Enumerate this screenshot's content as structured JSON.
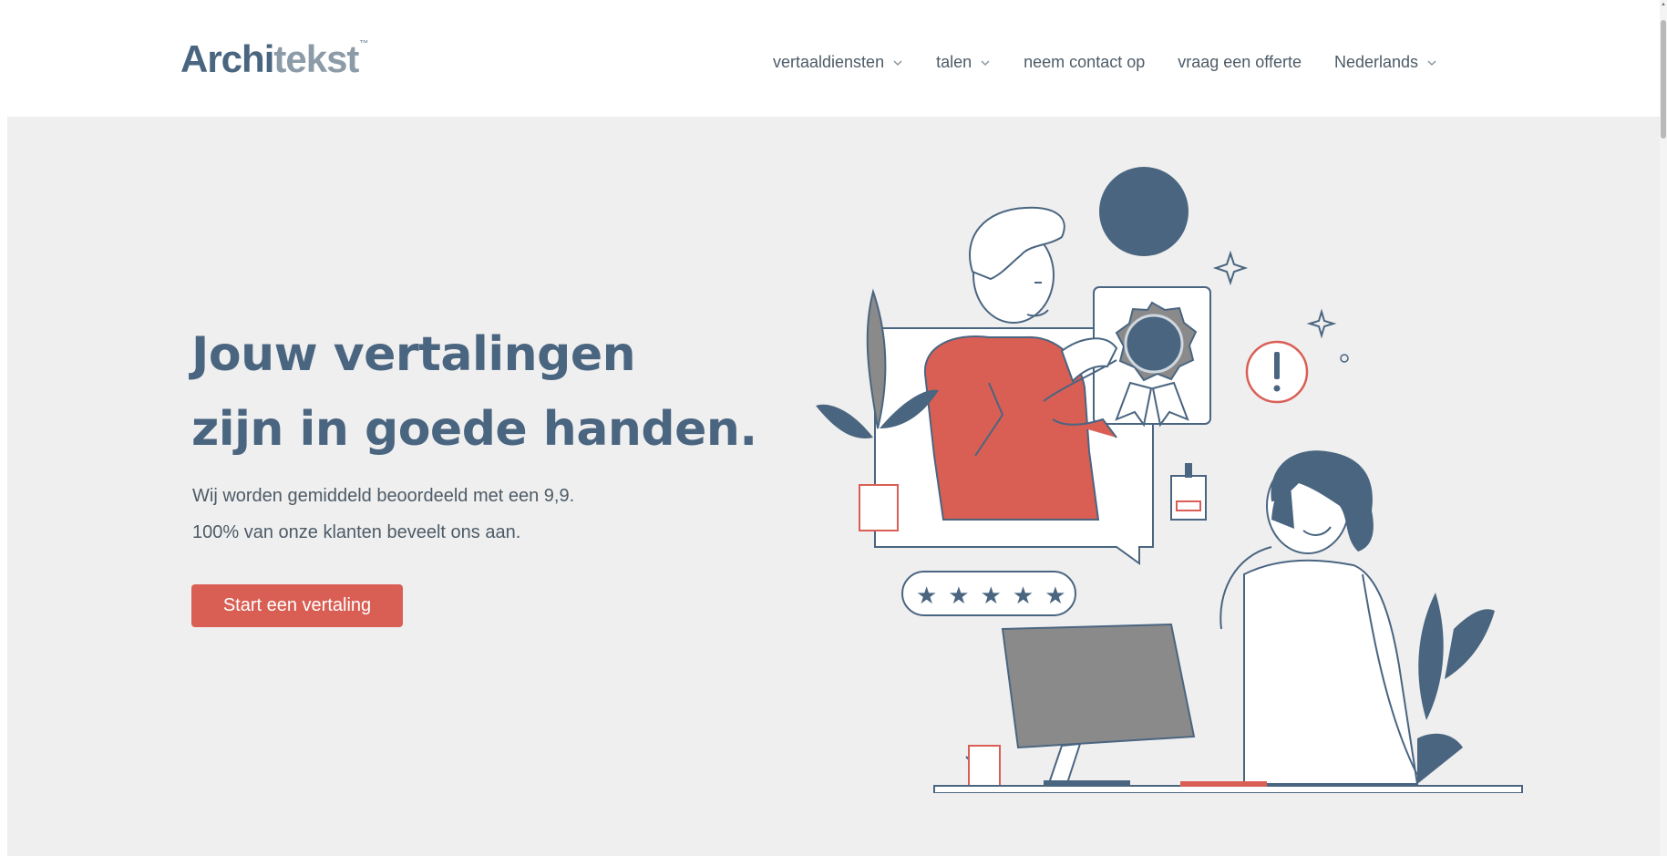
{
  "header": {
    "logo": {
      "part_a": "Archi",
      "part_b": "tekst",
      "trademark": "™"
    },
    "nav": [
      {
        "label": "vertaaldiensten",
        "has_dropdown": true
      },
      {
        "label": "talen",
        "has_dropdown": true
      },
      {
        "label": "neem contact op",
        "has_dropdown": false
      },
      {
        "label": "vraag een offerte",
        "has_dropdown": false
      },
      {
        "label": "Nederlands",
        "has_dropdown": true
      }
    ]
  },
  "hero": {
    "title_line1": "Jouw vertalingen",
    "title_line2": "zijn in goede handen.",
    "subtitle_line1": "Wij worden gemiddeld beoordeeld met een 9,9.",
    "subtitle_line2": "100% van onze klanten beveelt ons aan.",
    "cta_label": "Start een vertaling",
    "rating_stars": 5,
    "illustration_icons": [
      "man-with-badge",
      "woman-on-phone",
      "computer-monitor",
      "plant",
      "rating-stars",
      "exclamation-icon",
      "sparkle-icon"
    ]
  },
  "colors": {
    "brand_blue": "#4a6580",
    "accent_red": "#d95f55",
    "hero_bg": "#efefef",
    "text": "#4d5b67"
  }
}
